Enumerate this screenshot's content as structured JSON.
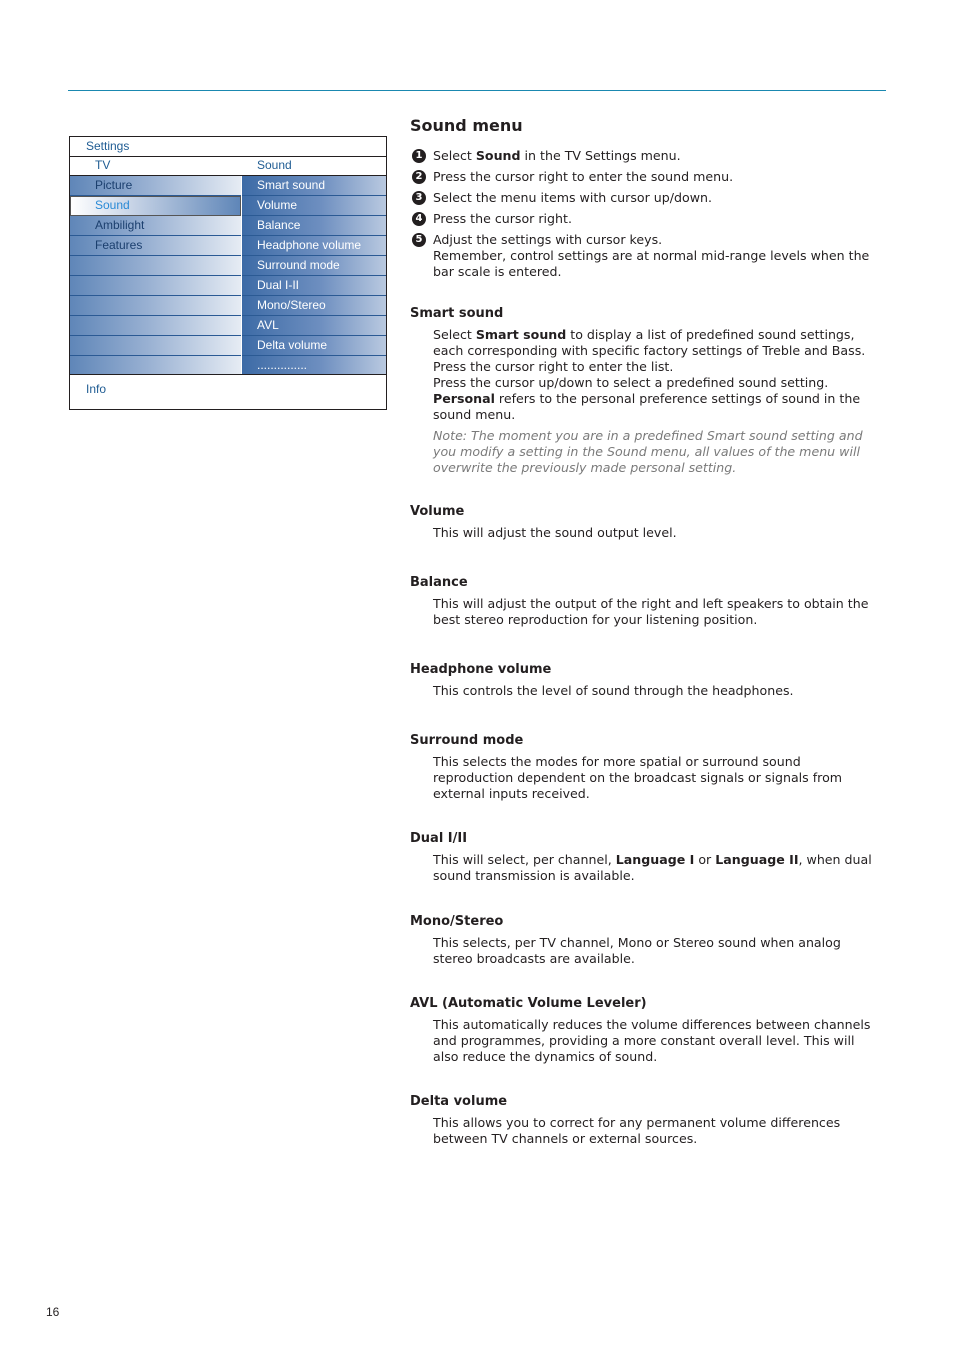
{
  "accent_color": "#1a88b0",
  "tv_menu": {
    "title": "Settings",
    "left_header": "TV",
    "right_header": "Sound",
    "left_items": [
      "Picture",
      "Sound",
      "Ambilight",
      "Features",
      "",
      "",
      "",
      "",
      "",
      ""
    ],
    "selected_left": "Sound",
    "right_items": [
      "Smart sound",
      "Volume",
      "Balance",
      "Headphone volume",
      "Surround mode",
      "Dual I-II",
      "Mono/Stereo",
      "AVL",
      "Delta volume",
      "..............."
    ],
    "info": "Info"
  },
  "heading": "Sound menu",
  "steps": [
    {
      "num": "1",
      "pre": "Select ",
      "bold": "Sound",
      "post": " in the TV Settings menu."
    },
    {
      "num": "2",
      "pre": "Press the cursor right to enter the sound menu.",
      "bold": "",
      "post": ""
    },
    {
      "num": "3",
      "pre": "Select the menu items with cursor up/down.",
      "bold": "",
      "post": ""
    },
    {
      "num": "4",
      "pre": "Press the cursor right.",
      "bold": "",
      "post": ""
    },
    {
      "num": "5",
      "pre": "Adjust the settings with cursor keys.",
      "bold": "",
      "post": "",
      "extra": "Remember, control settings are at normal mid-range levels when the bar scale is entered."
    }
  ],
  "sections": {
    "smart_sound": {
      "title": "Smart sound",
      "l1_pre": "Select ",
      "l1_bold": "Smart sound",
      "l1_post": " to display a list of predefined sound settings, each corresponding with specific factory settings of Treble and Bass.",
      "l2": "Press the cursor right to enter the list.",
      "l3": "Press the cursor up/down to select a predefined sound setting.",
      "l4_bold": "Personal",
      "l4_post": " refers to the personal preference settings of sound in the sound menu.",
      "note": "Note: The moment you are in a predefined Smart sound setting and you modify a setting in the Sound menu, all values of the menu will overwrite the previously made personal setting."
    },
    "volume": {
      "title": "Volume",
      "text": "This will adjust the sound output level."
    },
    "balance": {
      "title": "Balance",
      "text": "This will adjust the output of the right and left speakers to obtain the best stereo reproduction for your listening position."
    },
    "headphone": {
      "title": "Headphone volume",
      "text": "This controls the level of sound through the headphones."
    },
    "surround": {
      "title": "Surround mode",
      "text": "This selects the modes for more spatial or surround sound reproduction dependent on the broadcast signals or signals from external inputs received."
    },
    "dual": {
      "title": "Dual I/II",
      "pre": "This will select, per channel, ",
      "b1": "Language I",
      "mid": " or ",
      "b2": "Language II",
      "post": ", when dual sound transmission is available."
    },
    "mono": {
      "title": "Mono/Stereo",
      "text": "This selects, per TV channel, Mono or Stereo sound when analog stereo broadcasts are available."
    },
    "avl": {
      "title": "AVL (Automatic Volume Leveler)",
      "text": "This automatically reduces the volume differences between channels and programmes, providing a more constant overall level. This will also reduce the dynamics of sound."
    },
    "delta": {
      "title": "Delta volume",
      "text": "This allows you to correct for any permanent volume differences between TV channels or external sources."
    }
  },
  "page_number": "16"
}
